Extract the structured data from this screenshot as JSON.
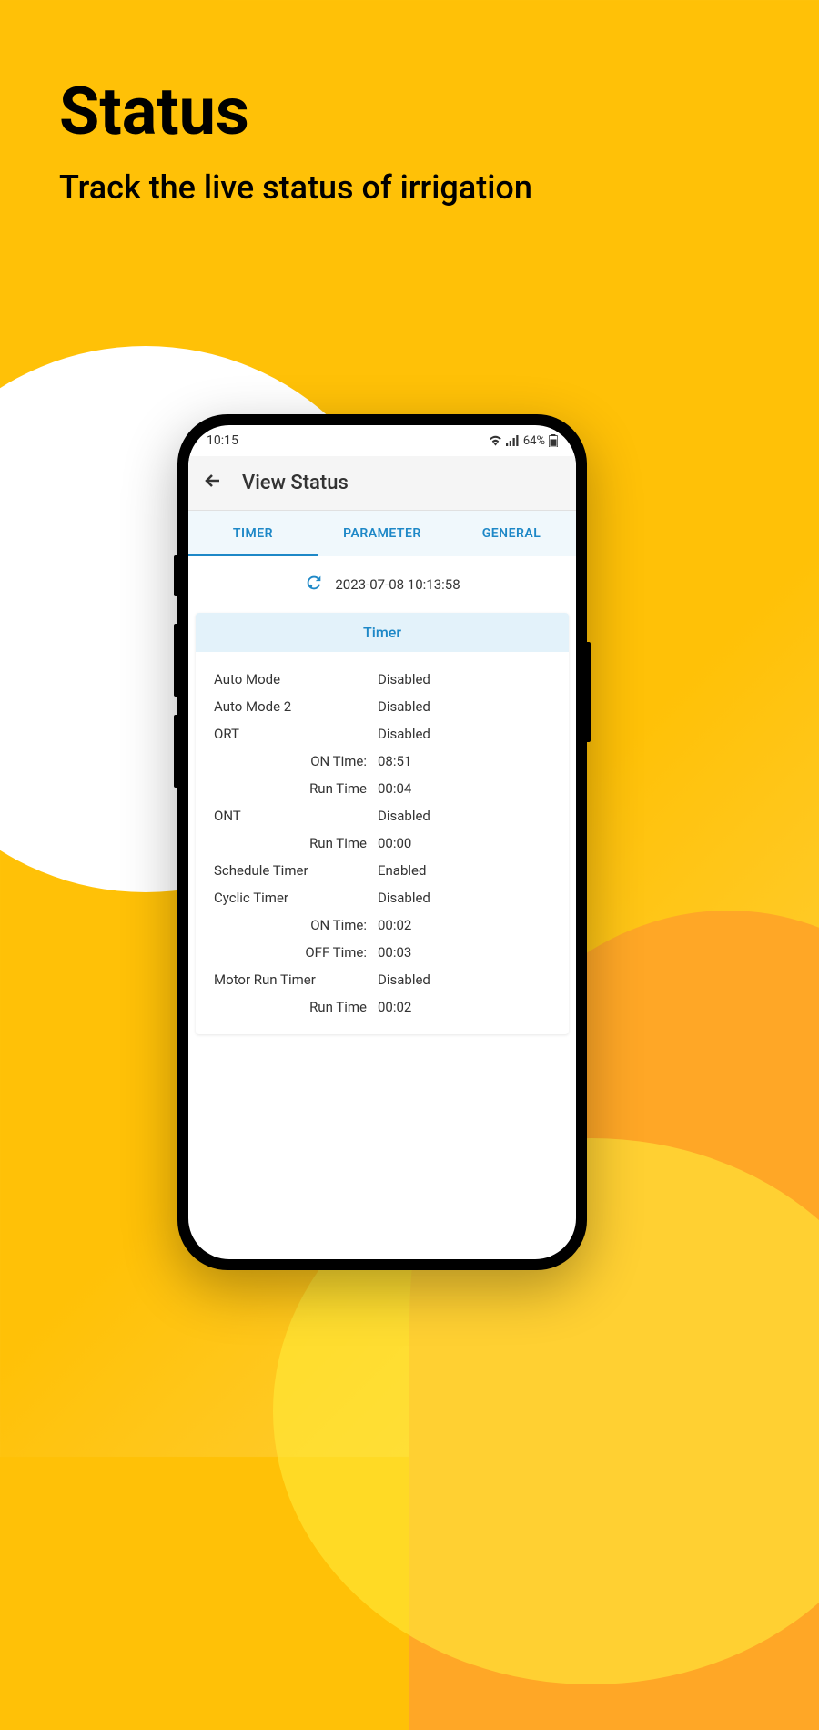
{
  "page": {
    "title": "Status",
    "subtitle": "Track the live status of irrigation"
  },
  "statusBar": {
    "time": "10:15",
    "battery": "64%"
  },
  "app": {
    "headerTitle": "View Status",
    "tabs": {
      "timer": "TIMER",
      "parameter": "PARAMETER",
      "general": "GENERAL"
    },
    "timestamp": "2023-07-08 10:13:58",
    "cardTitle": "Timer",
    "rows": [
      {
        "label": "Auto Mode",
        "value": "Disabled",
        "indent": false
      },
      {
        "label": "Auto Mode 2",
        "value": "Disabled",
        "indent": false
      },
      {
        "label": "ORT",
        "value": "Disabled",
        "indent": false
      },
      {
        "label": "ON Time:",
        "value": "08:51",
        "indent": true
      },
      {
        "label": "Run Time",
        "value": "00:04",
        "indent": true
      },
      {
        "label": "ONT",
        "value": "Disabled",
        "indent": false
      },
      {
        "label": "Run Time",
        "value": "00:00",
        "indent": true
      },
      {
        "label": "Schedule Timer",
        "value": "Enabled",
        "indent": false
      },
      {
        "label": "Cyclic Timer",
        "value": "Disabled",
        "indent": false
      },
      {
        "label": "ON Time:",
        "value": "00:02",
        "indent": true
      },
      {
        "label": "OFF Time:",
        "value": "00:03",
        "indent": true
      },
      {
        "label": "Motor Run Timer",
        "value": "Disabled",
        "indent": false
      },
      {
        "label": "Run Time",
        "value": "00:02",
        "indent": true
      }
    ]
  }
}
